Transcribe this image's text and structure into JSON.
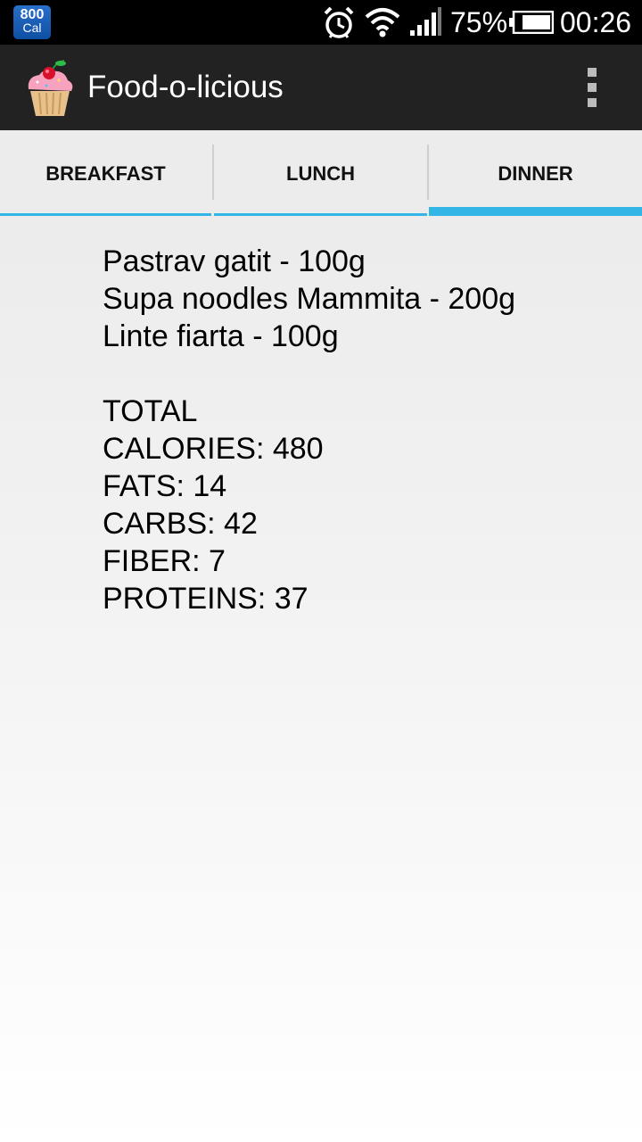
{
  "status_bar": {
    "app_badge": {
      "number": "800",
      "unit": "Cal"
    },
    "battery": "75%",
    "time": "00:26",
    "icons": [
      "alarm-icon",
      "wifi-icon",
      "signal-icon",
      "battery-icon"
    ]
  },
  "action_bar": {
    "title": "Food-o-licious",
    "app_icon": "cupcake-icon",
    "menu_icon": "overflow-menu-icon"
  },
  "tabs": [
    {
      "label": "BREAKFAST",
      "selected": false
    },
    {
      "label": "LUNCH",
      "selected": false
    },
    {
      "label": "DINNER",
      "selected": true
    }
  ],
  "accent_color": "#33b5e5",
  "meal": {
    "items": [
      "Pastrav gatit - 100g",
      "Supa noodles Mammita - 200g",
      "Linte fiarta - 100g"
    ],
    "total_heading": "TOTAL",
    "totals": [
      "CALORIES: 480",
      "FATS: 14",
      "CARBS: 42",
      "FIBER: 7",
      "PROTEINS: 37"
    ]
  }
}
